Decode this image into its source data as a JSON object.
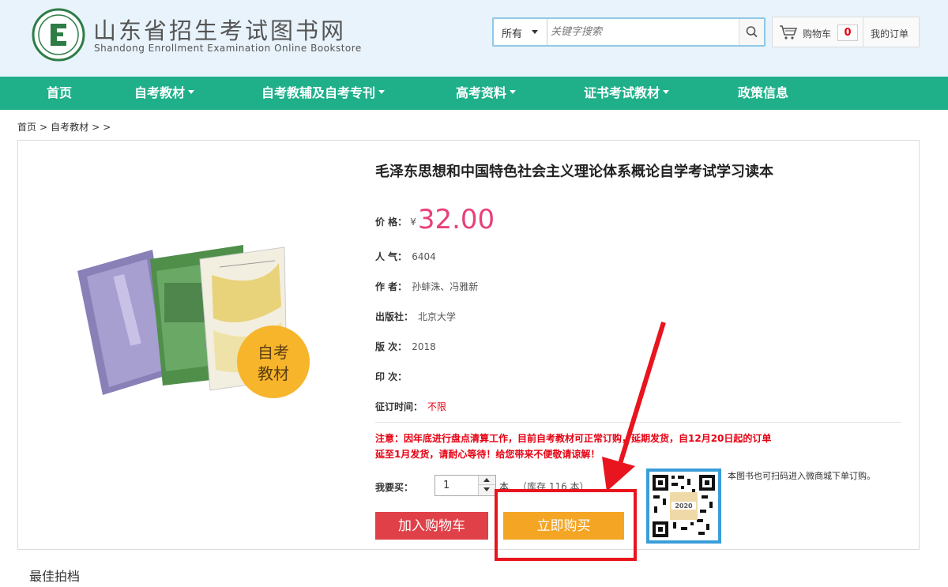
{
  "header": {
    "site_title": "山东省招生考试图书网",
    "site_subtitle": "Shandong Enrollment Examination Online Bookstore",
    "logo_icon": "circular-e-emblem-logo",
    "search": {
      "category": "所有",
      "placeholder": "关键字搜索"
    },
    "cart_label": "购物车",
    "cart_count": "0",
    "my_orders": "我的订单"
  },
  "nav": {
    "items": [
      {
        "label": "首页",
        "has_dropdown": false
      },
      {
        "label": "自考教材",
        "has_dropdown": true
      },
      {
        "label": "自考教辅及自考专刊",
        "has_dropdown": true
      },
      {
        "label": "高考资料",
        "has_dropdown": true
      },
      {
        "label": "证书考试教材",
        "has_dropdown": true
      },
      {
        "label": "政策信息",
        "has_dropdown": false
      }
    ]
  },
  "breadcrumb": {
    "home": "首页",
    "sep": ">",
    "category": "自考教材",
    "sep2": ">",
    "sep3": ">"
  },
  "product": {
    "title": "毛泽东思想和中国特色社会主义理论体系概论自学考试学习读本",
    "cover_badge_line1": "自考",
    "cover_badge_line2": "教材",
    "price_label": "价  格：",
    "price_currency": "¥",
    "price": "32.00",
    "popularity_label": "人  气：",
    "popularity": "6404",
    "author_label": "作  者：",
    "author": "孙蚌洙、冯雅新",
    "publisher_label": "出版社：",
    "publisher": "北京大学",
    "edition_label": "版  次：",
    "edition": "2018",
    "printing_label": "印  次：",
    "printing": "",
    "order_time_label": "征订时间：",
    "order_time": "不限",
    "notice_line1": "注意：因年底进行盘点清算工作，目前自考教材可正常订购，延期发货，自12月20日起的订单",
    "notice_line2": "延至1月发货，请耐心等待！给您带来不便敬请谅解！",
    "quantity_label": "我要买：",
    "quantity": "1",
    "quantity_unit": "本",
    "stock_text": "（库存 116 本）",
    "add_to_cart": "加入购物车",
    "buy_now": "立即购买",
    "qr_caption": "本图书也可扫码进入微商城下单订购。"
  },
  "section": {
    "best_match": "最佳拍档"
  },
  "colors": {
    "nav_bg": "#1fb08a",
    "header_bg": "#e8f3fb",
    "price": "#e8417a",
    "cart_button": "#e04048",
    "buy_button": "#f5a524",
    "annotation": "#e8141e"
  }
}
